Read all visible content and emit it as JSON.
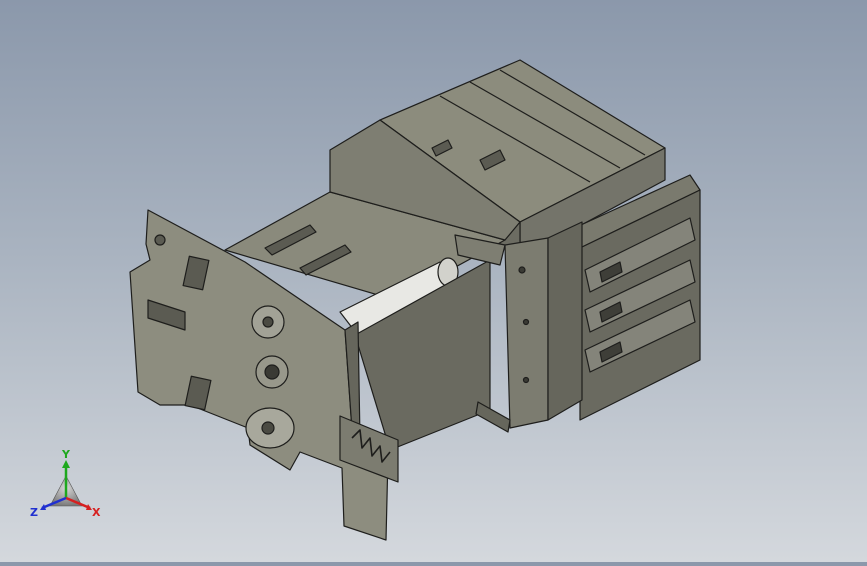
{
  "colors": {
    "bg_top": "#8b98ab",
    "bg_bottom": "#d4d8dd",
    "body_light": "#8c8c7d",
    "body_mid": "#74746a",
    "body_dark": "#5b5b52",
    "edge": "#1e1e1c",
    "coil_white": "#e8e8e4",
    "axis_x": "#d62020",
    "axis_y": "#1ea81e",
    "axis_z": "#2030d0"
  },
  "viewport": {
    "name": "3d-model-viewport"
  },
  "triad": {
    "x_label": "X",
    "y_label": "Y",
    "z_label": "Z"
  }
}
